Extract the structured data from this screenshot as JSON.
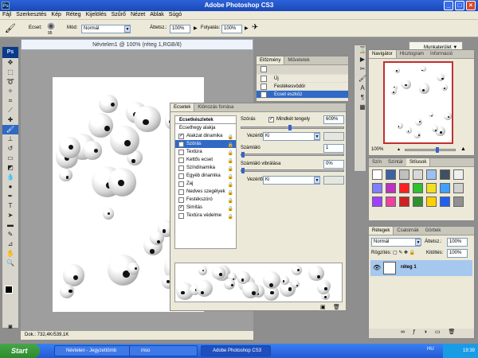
{
  "window": {
    "title": "Adobe Photoshop CS3",
    "app_icon": "Ps"
  },
  "menu": [
    "Fájl",
    "Szerkesztés",
    "Kép",
    "Réteg",
    "Kijelölés",
    "Szűrő",
    "Nézet",
    "Ablak",
    "Súgó"
  ],
  "options": {
    "brush_label": "Ecset:",
    "brush_size": "95",
    "mode_label": "Mód:",
    "mode_value": "Normál",
    "opacity_label": "Áttetsz.:",
    "opacity_value": "100%",
    "flow_label": "Folyatás:",
    "flow_value": "100%",
    "workspace_label": "Munkaterület"
  },
  "document": {
    "title": "Névtelen1 @ 100% (réteg 1,RGB/8)",
    "status": "Dok.: 732,4K/539,1K"
  },
  "history_panel": {
    "tabs": [
      "Előzmény",
      "Műveletek"
    ],
    "items": [
      {
        "label": "Új"
      },
      {
        "label": "Festékesvödör"
      },
      {
        "label": "Ecset eszköz"
      }
    ]
  },
  "brushes_panel": {
    "tabs": [
      "Ecsetek",
      "Klónozás forrása"
    ],
    "list": [
      {
        "label": "Ecsetkészletek",
        "checkbox": false,
        "checked": false
      },
      {
        "label": "Ecsethegy alakja",
        "checkbox": false,
        "checked": false
      },
      {
        "label": "Alakzat dinamika",
        "checkbox": true,
        "checked": true
      },
      {
        "label": "Szórás",
        "checkbox": true,
        "checked": true
      },
      {
        "label": "Textúra",
        "checkbox": true,
        "checked": false
      },
      {
        "label": "Kettős ecset",
        "checkbox": true,
        "checked": false
      },
      {
        "label": "Színdinamika",
        "checkbox": true,
        "checked": false
      },
      {
        "label": "Egyéb dinamika",
        "checkbox": true,
        "checked": false
      },
      {
        "label": "Zaj",
        "checkbox": true,
        "checked": false
      },
      {
        "label": "Nedves szegélyek",
        "checkbox": true,
        "checked": false
      },
      {
        "label": "Festékszóró",
        "checkbox": true,
        "checked": false
      },
      {
        "label": "Simítás",
        "checkbox": true,
        "checked": true
      },
      {
        "label": "Textúra védelme",
        "checkbox": true,
        "checked": false
      }
    ],
    "selected_index": 3,
    "scatter_label": "Szórás",
    "both_axes_label": "Mindkét tengely",
    "scatter_value": "609%",
    "control_label": "Vezérlő:",
    "control_value": "Ki",
    "count_label": "Számláló",
    "count_value": "1",
    "count_jitter_label": "Számláló vibrálása",
    "count_jitter_value": "0%",
    "control2_label": "Vezérlő:",
    "control2_value": "Ki",
    "scatter_level": 0.47,
    "count_jitter_level": 0
  },
  "navigator_panel": {
    "tabs": [
      "Navigátor",
      "Hisztogram",
      "Információ"
    ],
    "zoom": "100%"
  },
  "swatches_panel": {
    "tabs": [
      "Szín",
      "Színtár",
      "Stílusok"
    ]
  },
  "layers_panel": {
    "tabs": [
      "Rétegek",
      "Csatornák",
      "Görbék"
    ],
    "blend_mode": "Normál",
    "opacity_label": "Áttetsz.:",
    "opacity_value": "100%",
    "lock_label": "Rögzítés:",
    "fill_label": "Kitöltés:",
    "fill_value": "100%",
    "layers": [
      {
        "name": "réteg 1"
      }
    ]
  },
  "taskbar": {
    "start": "Start",
    "buttons": [
      "Névtelen - Jegyzettömb",
      "mso",
      "Adobe Photoshop CS3"
    ],
    "active_index": 2,
    "lang": "HU",
    "time": "19:39"
  },
  "colors": {
    "xp_blue": "#2458d4",
    "selection": "#316ac5",
    "panel_bg": "#ece9d8",
    "layer_sel": "#a6c8ee"
  }
}
